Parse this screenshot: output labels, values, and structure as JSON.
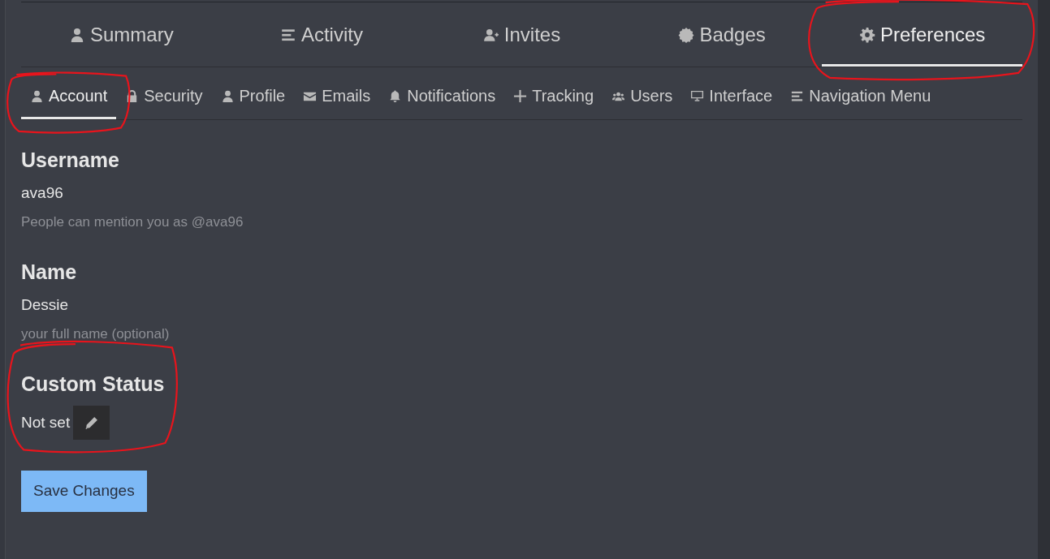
{
  "main_tabs": [
    {
      "label": "Summary",
      "selected": false,
      "circled": false
    },
    {
      "label": "Activity",
      "selected": false,
      "circled": false
    },
    {
      "label": "Invites",
      "selected": false,
      "circled": false
    },
    {
      "label": "Badges",
      "selected": false,
      "circled": false
    },
    {
      "label": "Preferences",
      "selected": true,
      "circled": true
    }
  ],
  "sub_tabs": [
    {
      "label": "Account",
      "selected": true,
      "circled": true
    },
    {
      "label": "Security",
      "selected": false,
      "circled": false
    },
    {
      "label": "Profile",
      "selected": false,
      "circled": false
    },
    {
      "label": "Emails",
      "selected": false,
      "circled": false
    },
    {
      "label": "Notifications",
      "selected": false,
      "circled": false
    },
    {
      "label": "Tracking",
      "selected": false,
      "circled": false
    },
    {
      "label": "Users",
      "selected": false,
      "circled": false
    },
    {
      "label": "Interface",
      "selected": false,
      "circled": false
    },
    {
      "label": "Navigation Menu",
      "selected": false,
      "circled": false
    }
  ],
  "sections": [
    {
      "kind": "text",
      "title": "Username",
      "value": "ava96",
      "help": "People can mention you as @ava96",
      "circled": false
    },
    {
      "kind": "text",
      "title": "Name",
      "value": "Dessie",
      "help": "your full name (optional)",
      "circled": false
    },
    {
      "kind": "status",
      "title": "Custom Status",
      "value": "Not set",
      "circled": true
    }
  ],
  "save_button": "Save Changes"
}
